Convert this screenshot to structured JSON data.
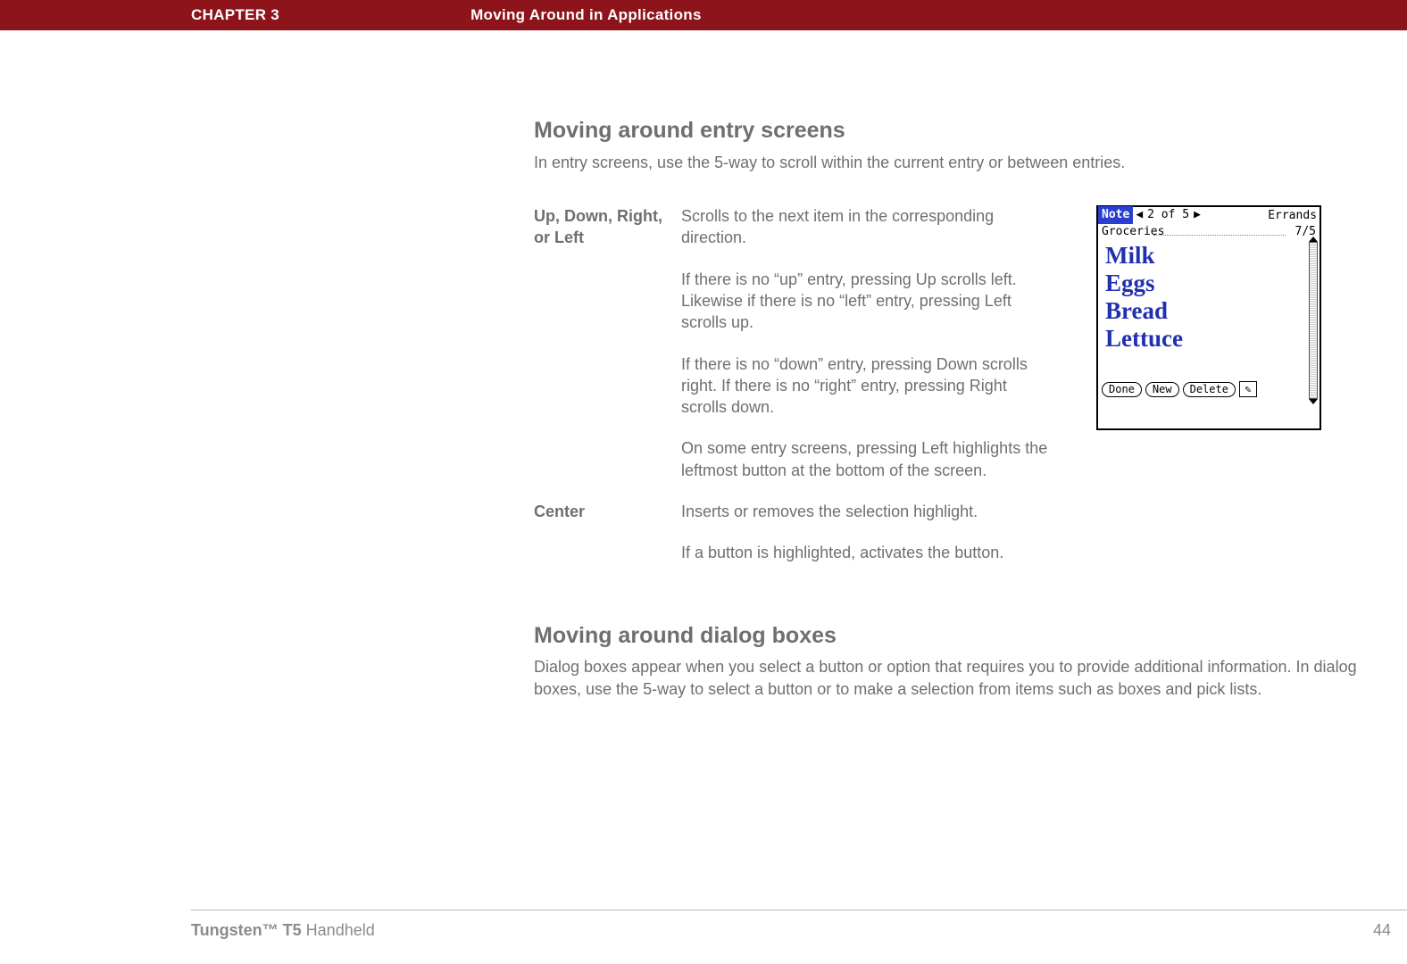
{
  "header": {
    "chapter": "CHAPTER 3",
    "title": "Moving Around in Applications"
  },
  "section1": {
    "heading": "Moving around entry screens",
    "intro": "In entry screens, use the 5-way to scroll within the current entry or between entries.",
    "rows": [
      {
        "term": "Up, Down, Right, or Left",
        "paras": [
          "Scrolls to the next item in the corresponding direction.",
          "If there is no “up” entry, pressing Up scrolls left. Likewise if there is no “left” entry, pressing Left scrolls up.",
          "If there is no “down” entry, pressing Down scrolls right. If there is no “right” entry, pressing Right scrolls down.",
          "On some entry screens, pressing Left highlights the leftmost button at the bottom of the screen."
        ]
      },
      {
        "term": "Center",
        "paras": [
          "Inserts or removes the selection highlight.",
          "If a button is highlighted, activates the button."
        ]
      }
    ]
  },
  "section2": {
    "heading": "Moving around dialog boxes",
    "intro": "Dialog boxes appear when you select a button or option that requires you to provide additional information. In dialog boxes, use the 5-way to select a button or to make a selection from items such as boxes and pick lists."
  },
  "device": {
    "note_label": "Note",
    "arrow_left": "◀",
    "count": "2 of 5",
    "arrow_right": "▶",
    "category": "Errands",
    "subtitle": "Groceries",
    "date": "7/5",
    "handwriting": "Milk\nEggs\nBread\nLettuce",
    "buttons": {
      "done": "Done",
      "new": "New",
      "delete": "Delete"
    },
    "pen_glyph": "✎"
  },
  "footer": {
    "product_bold": "Tungsten™ T5",
    "product_rest": " Handheld",
    "page_number": "44"
  }
}
